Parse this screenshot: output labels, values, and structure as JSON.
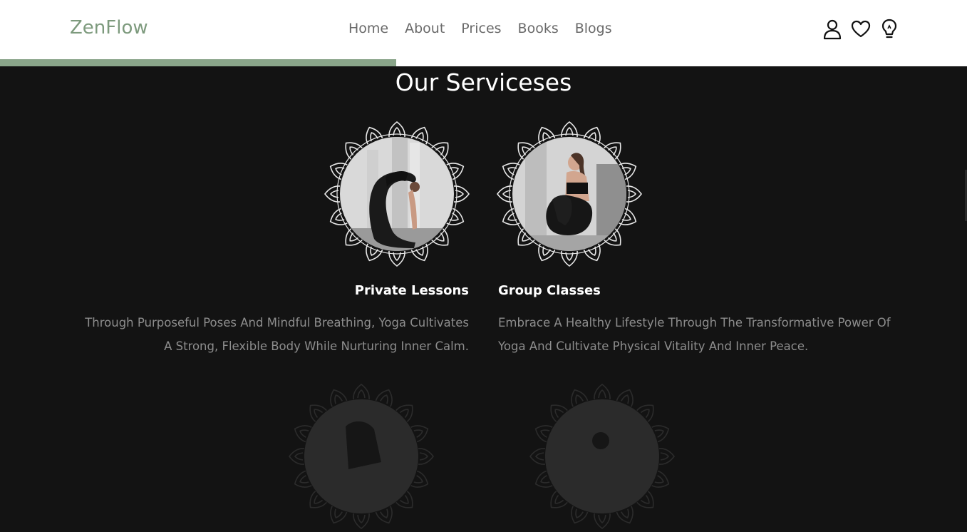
{
  "header": {
    "logo": "ZenFlow",
    "nav": [
      "Home",
      "About",
      "Prices",
      "Books",
      "Blogs"
    ],
    "icons": [
      "user-icon",
      "heart-icon",
      "lightbulb-icon"
    ],
    "scroll_progress": 0.41
  },
  "section": {
    "title": "Our Serviceses",
    "cards": [
      {
        "title": "Private Lessons",
        "description_line1": "Through Purposeful Poses And Mindful Breathing, Yoga Cultivates",
        "description_line2": "A Strong, Flexible Body While Nurturing Inner Calm."
      },
      {
        "title": "Group Classes",
        "description_line1": "Embrace A Healthy Lifestyle Through The Transformative Power Of",
        "description_line2": "Yoga And Cultivate Physical Vitality And Inner Peace."
      }
    ]
  },
  "colors": {
    "accent": "#7d9a7d",
    "progress": "#8aa58a",
    "background": "#131313",
    "header_bg": "#ffffff",
    "nav_text": "#6a6a6a",
    "description_text": "#8d8d8d"
  }
}
